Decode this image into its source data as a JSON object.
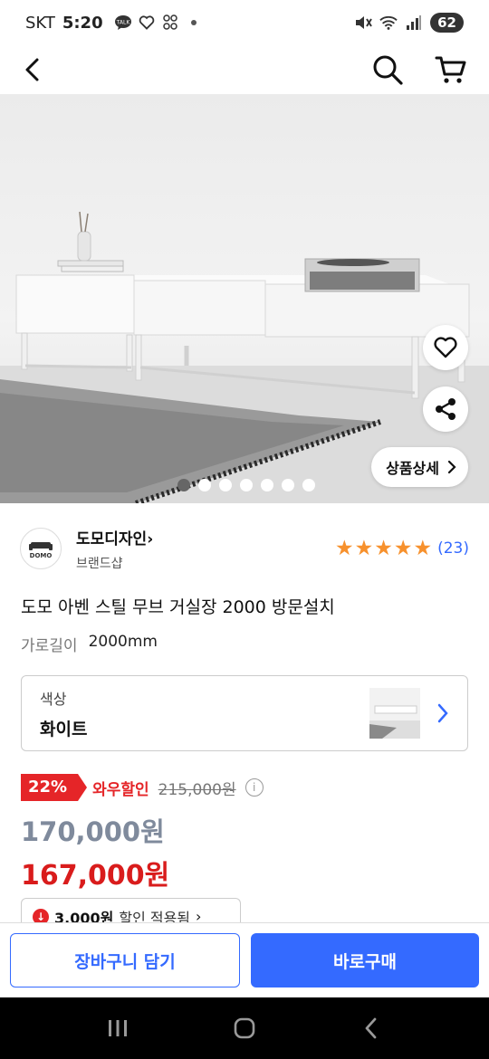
{
  "status_bar": {
    "carrier": "SKT",
    "time": "5:20",
    "talk_label": "TALK",
    "battery": "62"
  },
  "nav": {
    "back_icon": "chevron-left-icon",
    "search_icon": "search-icon",
    "cart_icon": "cart-icon"
  },
  "hero": {
    "detail_button": "상품상세",
    "image_count": 7,
    "active_index": 0
  },
  "brand": {
    "logo_text": "DOMO",
    "name": "도모디자인",
    "chevron": "›",
    "subtitle": "브랜드샵"
  },
  "rating": {
    "stars": 5,
    "count": "(23)"
  },
  "product": {
    "title": "도모 아벤 스틸 무브 거실장 2000 방문설치",
    "option_label": "가로길이",
    "option_value": "2000mm"
  },
  "selector": {
    "label": "색상",
    "value": "화이트"
  },
  "price": {
    "discount": "22%",
    "wow_label": "와우할인",
    "original": "215,000원",
    "info_icon": "i",
    "sale": "170,000원",
    "final": "167,000원"
  },
  "coupon": {
    "amount": "3,000원",
    "text": "할인 적용됨",
    "chevron": "›"
  },
  "bottom_bar": {
    "cart_button": "장바구니 담기",
    "buy_button": "바로구매"
  },
  "colors": {
    "accent": "#346aff",
    "discount_red": "#e52528",
    "star": "#f7912d",
    "final_price": "#d91c1c"
  }
}
